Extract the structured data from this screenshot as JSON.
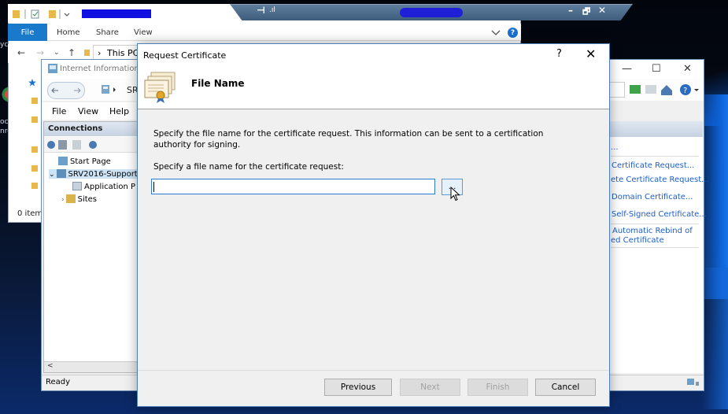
{
  "rdp_bar": {
    "pin": "⊣",
    "signal": ".ıl",
    "minimize": "–",
    "restore": "🗗",
    "close": "✕"
  },
  "explorer": {
    "ribbon_tabs": [
      "File",
      "Home",
      "Share",
      "View"
    ],
    "breadcrumb_sep": "›",
    "address_text": "This PC",
    "status_items": "0 item"
  },
  "desktop": {
    "text_1": "yc",
    "text_2": "oc",
    "text_3": "nro"
  },
  "iis": {
    "title": "Internet Information",
    "address_fragment": "SR",
    "menu": [
      "File",
      "View",
      "Help"
    ],
    "connections_header": "Connections",
    "tree": {
      "start_page": "Start Page",
      "server": "SRV2016-Support",
      "app_pools": "Application P",
      "sites": "Sites"
    },
    "scroll_arrow": "<",
    "status": "Ready",
    "window_controls": {
      "minimize": "—",
      "maximize": "☐",
      "close": "✕"
    },
    "actions": {
      "ellipsis": "...",
      "create_cert_request": "Certificate Request...",
      "complete_cert_request": "ete Certificate Request...",
      "domain_cert": "Domain Certificate...",
      "self_signed": "Self-Signed Certificate...",
      "auto_rebind_line1": "Automatic Rebind of",
      "auto_rebind_line2": "ed Certificate"
    }
  },
  "dialog": {
    "title": "Request Certificate",
    "help": "?",
    "close": "✕",
    "header_title": "File Name",
    "description": "Specify the file name for the certificate request. This information can be sent to a certification authority for signing.",
    "field_label": "Specify a file name for the certificate request:",
    "file_name_value": "",
    "browse_label": "...",
    "buttons": {
      "previous": "Previous",
      "next": "Next",
      "finish": "Finish",
      "cancel": "Cancel"
    }
  },
  "colors": {
    "file_tab": "#1979ca",
    "dialog_border": "#4d7fb8",
    "input_focus": "#2b7cd3",
    "action_link": "#1c5ec7",
    "redaction": "#1010e0"
  }
}
